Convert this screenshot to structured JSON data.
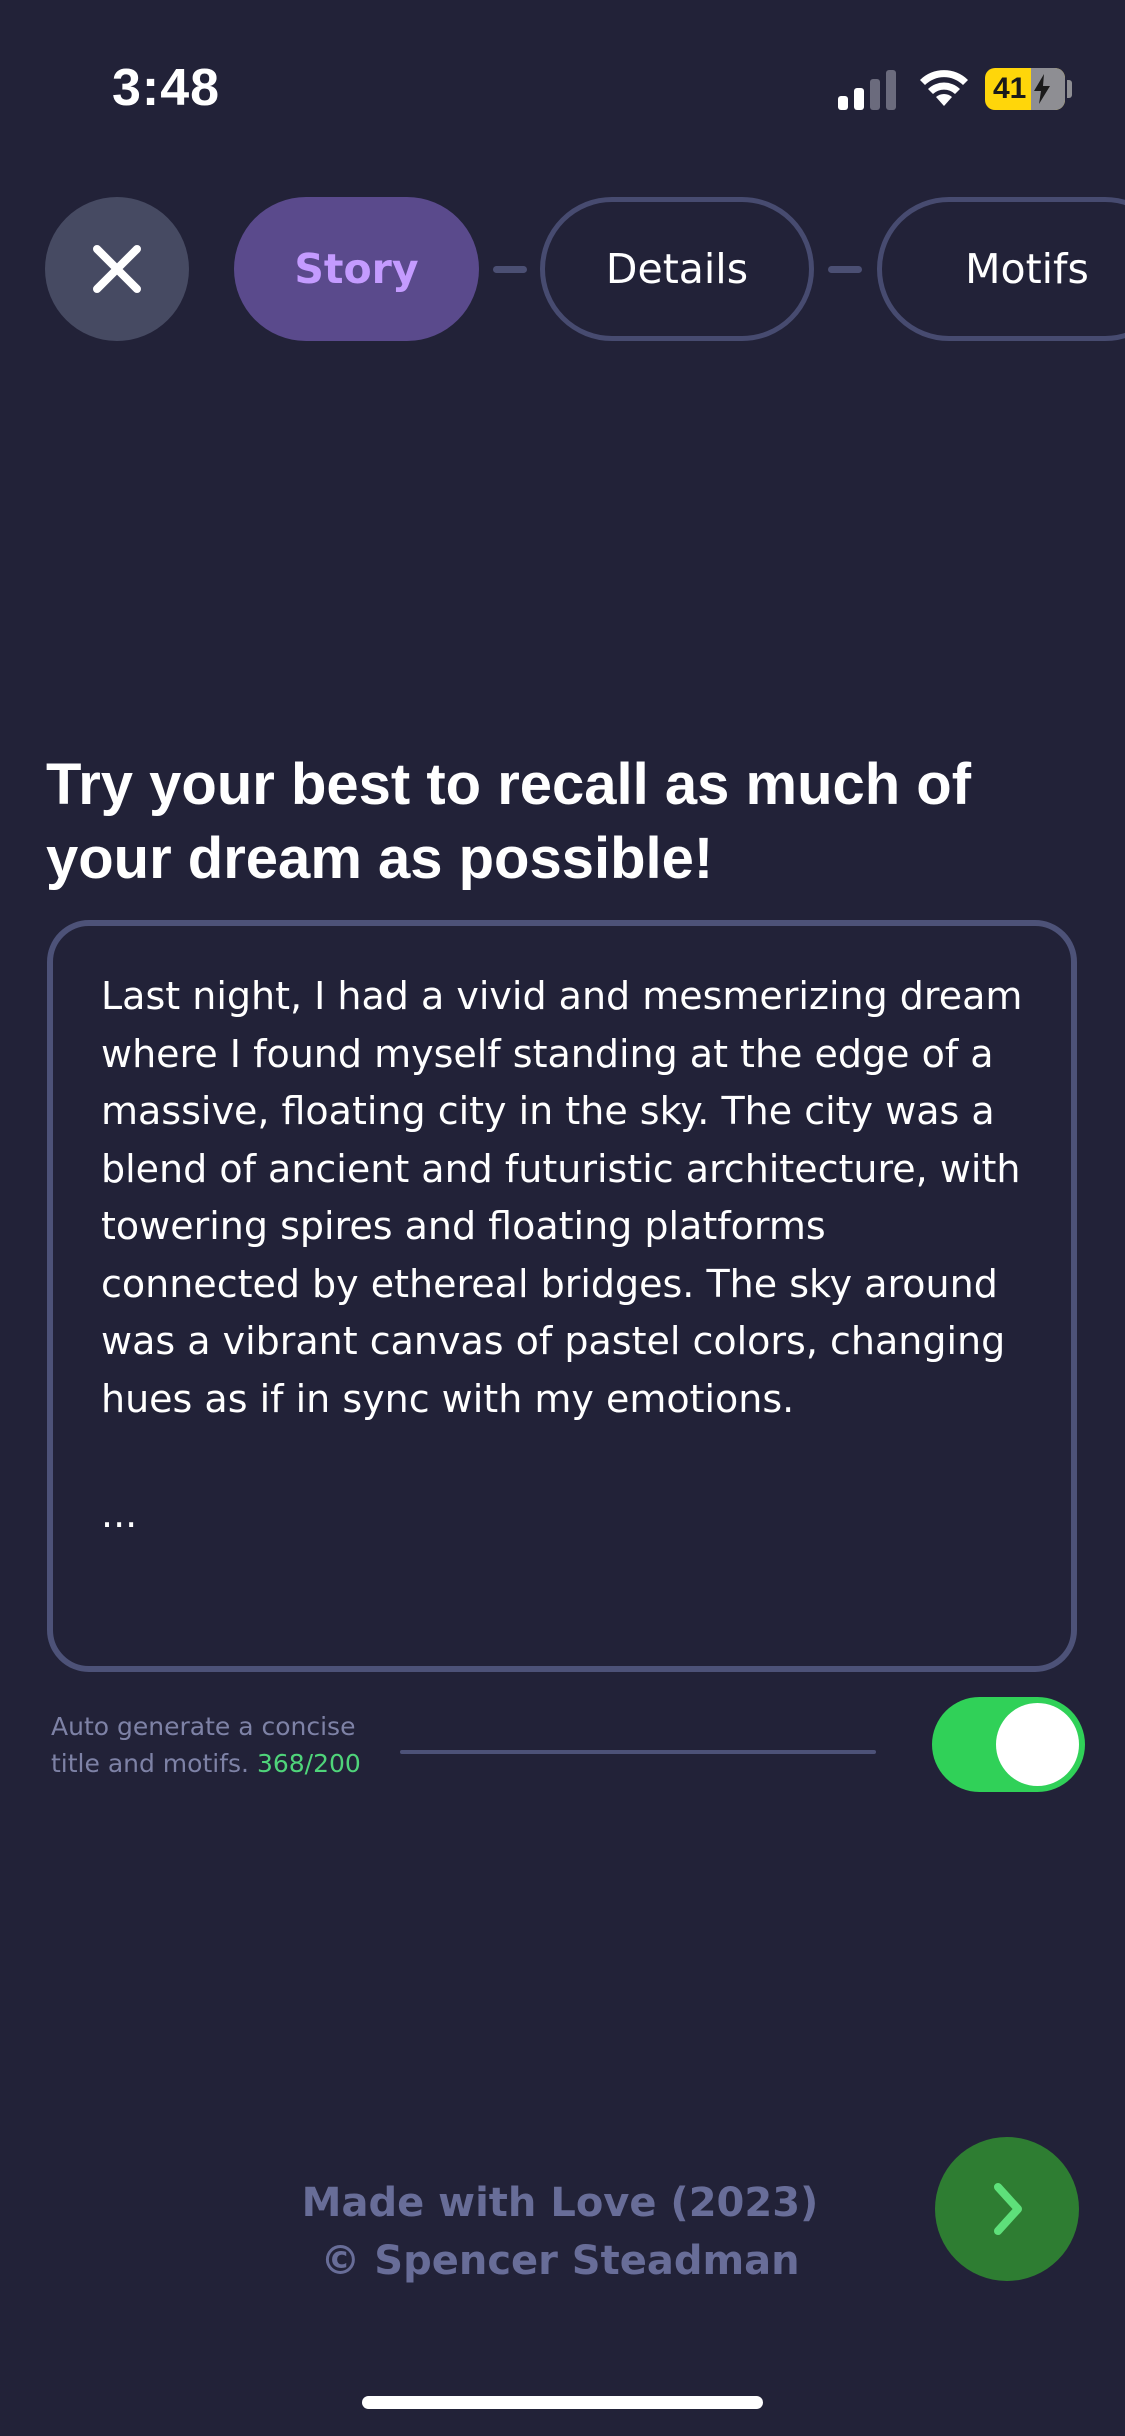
{
  "status_bar": {
    "time": "3:48",
    "battery": "41",
    "icons": [
      "signal-icon",
      "wifi-icon",
      "battery-charging-icon"
    ]
  },
  "steps": {
    "close_icon": "close-icon",
    "items": [
      {
        "label": "Story",
        "active": true
      },
      {
        "label": "Details",
        "active": false
      },
      {
        "label": "Motifs",
        "active": false
      }
    ]
  },
  "prompt": {
    "title": "Try your best to recall as much of your dream as possible!"
  },
  "dream": {
    "text": "Last night, I had a vivid and mesmerizing dream where I found myself standing at the edge of a massive, floating city in the sky. The city was a blend of ancient and futuristic architecture, with towering spires and floating platforms connected by ethereal bridges. The sky around was a vibrant canvas of pastel colors, changing hues as if in sync with my emotions.\n\n..."
  },
  "auto_generate": {
    "label": "Auto generate a concise title and motifs.",
    "count": "368/200",
    "enabled": true
  },
  "footer": {
    "line1": "Made with Love (2023)",
    "line2": "© Spencer Steadman"
  },
  "next": {
    "icon": "chevron-right-icon"
  },
  "colors": {
    "background": "#222238",
    "accent_purple": "#c49bff",
    "pill_active": "#5a4a8c",
    "border": "#4d5278",
    "toggle_on": "#30d158",
    "next_button": "#2e7d32",
    "count_green": "#4fd47a"
  }
}
